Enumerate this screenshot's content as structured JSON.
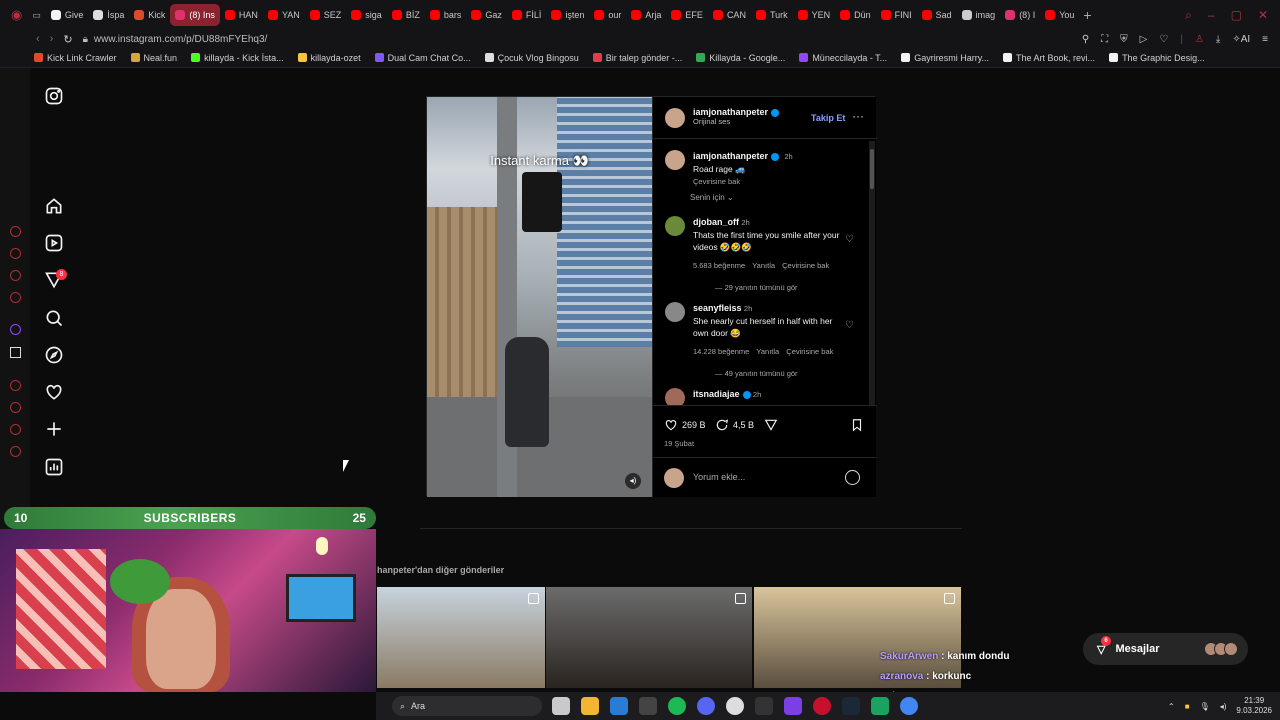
{
  "browser": {
    "tabs": [
      {
        "label": "Give",
        "color": "#f2f2f2"
      },
      {
        "label": "İspa",
        "color": "#dddddd"
      },
      {
        "label": "Kick",
        "color": "#e04a2a"
      },
      {
        "label": "(8) Ins",
        "color": "#e1306c",
        "active": true
      },
      {
        "label": "HAN",
        "color": "#ff0000"
      },
      {
        "label": "YAN",
        "color": "#ff0000"
      },
      {
        "label": "SEZ",
        "color": "#ff0000"
      },
      {
        "label": "siga",
        "color": "#ff0000"
      },
      {
        "label": "BİZ",
        "color": "#ff0000"
      },
      {
        "label": "bars",
        "color": "#ff0000"
      },
      {
        "label": "Gaz",
        "color": "#ff0000"
      },
      {
        "label": "FİLİ",
        "color": "#ff0000"
      },
      {
        "label": "işten",
        "color": "#ff0000"
      },
      {
        "label": "our",
        "color": "#ff0000"
      },
      {
        "label": "Arja",
        "color": "#ff0000"
      },
      {
        "label": "EFE",
        "color": "#ff0000"
      },
      {
        "label": "CAN",
        "color": "#ff0000"
      },
      {
        "label": "Turk",
        "color": "#ff0000"
      },
      {
        "label": "YEN",
        "color": "#ff0000"
      },
      {
        "label": "Dün",
        "color": "#ff0000"
      },
      {
        "label": "FINI",
        "color": "#ff0000"
      },
      {
        "label": "Sad",
        "color": "#ff0000"
      },
      {
        "label": "imag",
        "color": "#cccccc"
      },
      {
        "label": "(8) I",
        "color": "#e1306c"
      },
      {
        "label": "You",
        "color": "#ff0000"
      }
    ],
    "url": "www.instagram.com/p/DU88mFYEhq3/",
    "bookmarks": [
      {
        "label": "Kick Link Crawler",
        "color": "#e04a2a"
      },
      {
        "label": "Neal.fun",
        "color": "#d8a24a"
      },
      {
        "label": "killayda - Kick İsta...",
        "color": "#53fc18"
      },
      {
        "label": "killayda-ozet",
        "color": "#f5c542"
      },
      {
        "label": "Dual Cam Chat Co...",
        "color": "#7f5af0"
      },
      {
        "label": "Çocuk Vlog Bingosu",
        "color": "#dddddd"
      },
      {
        "label": "Bir talep gönder -...",
        "color": "#e8394f"
      },
      {
        "label": "Killayda - Google...",
        "color": "#34a853"
      },
      {
        "label": "Müneccilayda - T...",
        "color": "#9146ff"
      },
      {
        "label": "Gayriresmi Harry...",
        "color": "#f2f2f2"
      },
      {
        "label": "The Art Book, revi...",
        "color": "#f2f2f2"
      },
      {
        "label": "The Graphic Desig...",
        "color": "#f2f2f2"
      }
    ]
  },
  "instagram": {
    "nav_badge": "8",
    "post": {
      "caption_overlay": "Instant karma 👀",
      "author": "iamjonathanpeter",
      "audio": "Orijinal ses",
      "follow_label": "Takip Et",
      "caption_author": "iamjonathanpeter",
      "caption_time": "2h",
      "caption_text": "Road rage 🚙",
      "caption_translate": "Çevirisine bak",
      "sort_label": "Senin için",
      "comments": [
        {
          "user": "djoban_off",
          "time": "2h",
          "text": "Thats the first time you smile after your videos 🤣🤣🤣",
          "likes": "5.683 beğenme",
          "reply": "Yanıtla",
          "translate": "Çevirisine bak",
          "replies": "29 yanıtın tümünü gör"
        },
        {
          "user": "seanyfleiss",
          "time": "2h",
          "text": "She nearly cut herself in half with her own door 😂",
          "likes": "14.228 beğenme",
          "reply": "Yanıtla",
          "translate": "Çevirisine bak",
          "replies": "49 yanıtın tümünü gör"
        },
        {
          "user": "itsnadiajae",
          "time": "2h",
          "text": ""
        }
      ],
      "likes_count": "269 B",
      "comments_count": "4,5 B",
      "date": "19 Şubat",
      "comment_placeholder": "Yorum ekle..."
    },
    "more_posts_label": "hanpeter'dan diğer gönderiler",
    "messages_label": "Mesajlar",
    "messages_badge": "6"
  },
  "stream": {
    "sub_left": "10",
    "sub_title": "SUBSCRIBERS",
    "sub_right": "25",
    "chat": [
      {
        "user": "SakurArwen",
        "message": ": kanım dondu"
      },
      {
        "user": "azranova",
        "message": ": korkunc"
      },
      {
        "user": "SakurArwen",
        "message": ""
      }
    ]
  },
  "taskbar": {
    "search_label": "Ara",
    "time": "21:39",
    "date": "9.03.2026"
  }
}
